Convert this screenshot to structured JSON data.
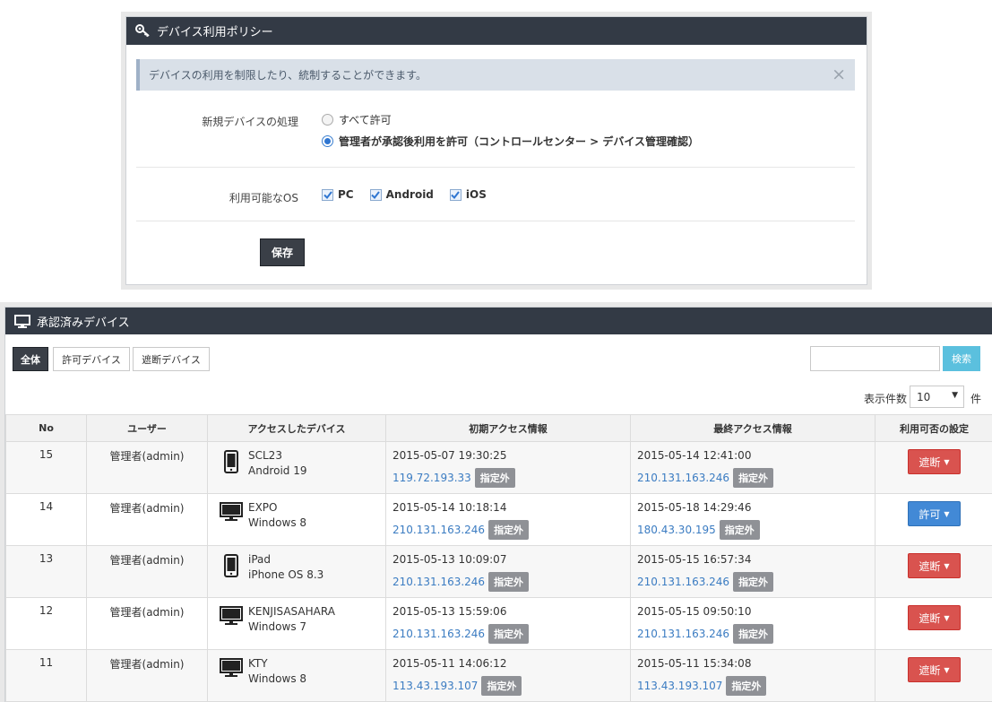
{
  "policy": {
    "title": "デバイス利用ポリシー",
    "header_icon": "key-icon",
    "alert_text": "デバイスの利用を制限したり、統制することができます。",
    "close_symbol": "×",
    "new_device_label": "新規デバイスの処理",
    "radio_options": [
      {
        "label": "すべて許可",
        "selected": false
      },
      {
        "label": "管理者が承認後利用を許可（コントロールセンター > デバイス管理確認）",
        "selected": true
      }
    ],
    "os_label": "利用可能なOS",
    "os_options": [
      {
        "label": "PC",
        "checked": true
      },
      {
        "label": "Android",
        "checked": true
      },
      {
        "label": "iOS",
        "checked": true
      }
    ],
    "save_label": "保存"
  },
  "devices": {
    "title": "承認済みデバイス",
    "header_icon": "monitor-icon",
    "filters": [
      "全体",
      "許可デバイス",
      "遮断デバイス"
    ],
    "active_filter": 0,
    "search": {
      "value": "",
      "placeholder": "",
      "button_label": "検索"
    },
    "per_page": {
      "label": "表示件数",
      "value": "10",
      "unit": "件"
    },
    "columns": [
      "No",
      "ユーザー",
      "アクセスしたデバイス",
      "初期アクセス情報",
      "最終アクセス情報",
      "利用可否の設定"
    ],
    "rows": [
      {
        "no": "15",
        "user": "管理者(admin)",
        "device_type": "phone",
        "device_name": "SCL23",
        "device_os": "Android 19",
        "first_time": "2015-05-07 19:30:25",
        "first_ip": "119.72.193.33",
        "first_badge": "指定外",
        "last_time": "2015-05-14 12:41:00",
        "last_ip": "210.131.163.246",
        "last_badge": "指定外",
        "action": "遮断",
        "action_type": "block"
      },
      {
        "no": "14",
        "user": "管理者(admin)",
        "device_type": "pc",
        "device_name": "EXPO",
        "device_os": "Windows 8",
        "first_time": "2015-05-14 10:18:14",
        "first_ip": "210.131.163.246",
        "first_badge": "指定外",
        "last_time": "2015-05-18 14:29:46",
        "last_ip": "180.43.30.195",
        "last_badge": "指定外",
        "action": "許可",
        "action_type": "allow"
      },
      {
        "no": "13",
        "user": "管理者(admin)",
        "device_type": "phone",
        "device_name": "iPad",
        "device_os": "iPhone OS 8.3",
        "first_time": "2015-05-13 10:09:07",
        "first_ip": "210.131.163.246",
        "first_badge": "指定外",
        "last_time": "2015-05-15 16:57:34",
        "last_ip": "210.131.163.246",
        "last_badge": "指定外",
        "action": "遮断",
        "action_type": "block"
      },
      {
        "no": "12",
        "user": "管理者(admin)",
        "device_type": "pc",
        "device_name": "KENJISASAHARA",
        "device_os": "Windows 7",
        "first_time": "2015-05-13 15:59:06",
        "first_ip": "210.131.163.246",
        "first_badge": "指定外",
        "last_time": "2015-05-15 09:50:10",
        "last_ip": "210.131.163.246",
        "last_badge": "指定外",
        "action": "遮断",
        "action_type": "block"
      },
      {
        "no": "11",
        "user": "管理者(admin)",
        "device_type": "pc",
        "device_name": "KTY",
        "device_os": "Windows 8",
        "first_time": "2015-05-11 14:06:12",
        "first_ip": "113.43.193.107",
        "first_badge": "指定外",
        "last_time": "2015-05-11 15:34:08",
        "last_ip": "113.43.193.107",
        "last_badge": "指定外",
        "action": "遮断",
        "action_type": "block"
      }
    ]
  }
}
